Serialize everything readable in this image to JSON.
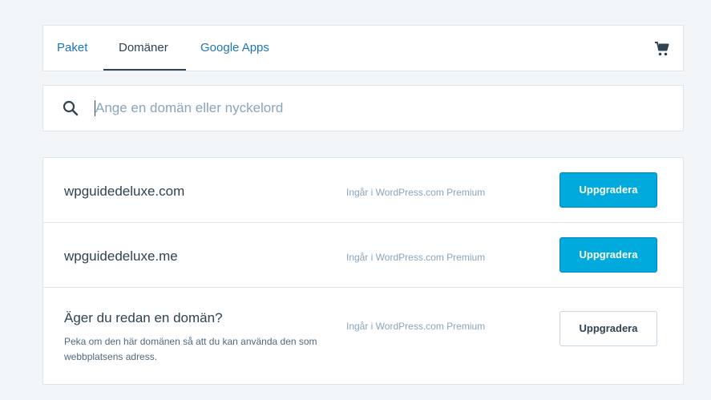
{
  "nav": {
    "tabs": [
      {
        "label": "Paket",
        "active": false
      },
      {
        "label": "Domäner",
        "active": true
      },
      {
        "label": "Google Apps",
        "active": false
      }
    ],
    "cart_icon": "cart-icon"
  },
  "search": {
    "placeholder": "Ange en domän eller nyckelord",
    "value": "",
    "icon": "search-icon"
  },
  "domains": [
    {
      "name": "wpguidedeluxe.com",
      "note": "Ingår i WordPress.com Premium",
      "button": "Uppgradera"
    },
    {
      "name": "wpguidedeluxe.me",
      "note": "Ingår i WordPress.com Premium",
      "button": "Uppgradera"
    }
  ],
  "existing": {
    "title": "Äger du redan en domän?",
    "description": "Peka om den här domänen så att du kan använda den som webbplatsens adress.",
    "note": "Ingår i WordPress.com Premium",
    "button": "Uppgradera"
  },
  "colors": {
    "link": "#1e74b8",
    "text": "#2e4453",
    "muted": "#87a6bc",
    "primary_button": "#00aadc",
    "background": "#f3f6f8"
  }
}
